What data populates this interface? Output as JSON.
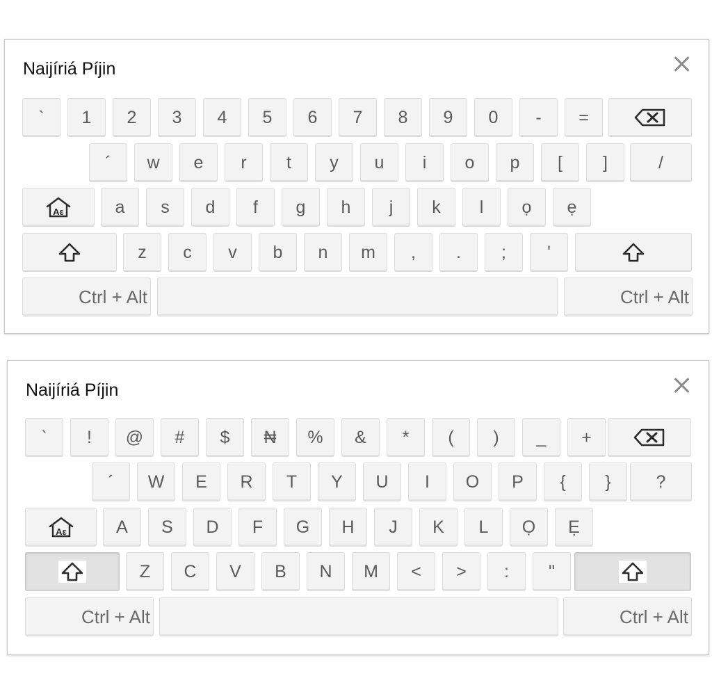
{
  "colors": {
    "panel_bg": "#ffffff",
    "panel_border": "#c8c8c8",
    "key_bg": "#f3f3f3",
    "key_border": "#dcdcdc",
    "key_active_bg": "#e2e2e2",
    "key_text": "#5a5a5a",
    "title_text": "#111111",
    "close_icon": "#8a8a8a"
  },
  "icons": {
    "backspace": "backspace-icon",
    "shift": "shift-icon",
    "layout": "home-layout-icon",
    "close": "close-icon"
  },
  "keyboards": [
    {
      "title": "Naijíriá Píjin",
      "rows": [
        [
          "`",
          "1",
          "2",
          "3",
          "4",
          "5",
          "6",
          "7",
          "8",
          "9",
          "0",
          "-",
          "=",
          "⌫"
        ],
        [
          "´",
          "w",
          "e",
          "r",
          "t",
          "y",
          "u",
          "i",
          "o",
          "p",
          "[",
          "]",
          "/"
        ],
        [
          "⌂",
          "a",
          "s",
          "d",
          "f",
          "g",
          "h",
          "j",
          "k",
          "l",
          "ọ",
          "ẹ"
        ],
        [
          "⇧",
          "z",
          "c",
          "v",
          "b",
          "n",
          "m",
          ",",
          ".",
          ";",
          "'",
          "⇧"
        ],
        [
          "Ctrl + Alt",
          "",
          "Ctrl + Alt"
        ]
      ],
      "shift_active": false
    },
    {
      "title": "Naijíriá Píjin",
      "rows": [
        [
          "`",
          "!",
          "@",
          "#",
          "$",
          "₦",
          "%",
          "&",
          "*",
          "(",
          ")",
          "_",
          "+",
          "⌫"
        ],
        [
          "´",
          "W",
          "E",
          "R",
          "T",
          "Y",
          "U",
          "I",
          "O",
          "P",
          "{",
          "}",
          "?"
        ],
        [
          "⌂",
          "A",
          "S",
          "D",
          "F",
          "G",
          "H",
          "J",
          "K",
          "L",
          "Ọ",
          "Ẹ"
        ],
        [
          "⇧",
          "Z",
          "C",
          "V",
          "B",
          "N",
          "M",
          "<",
          ">",
          ":",
          "\"",
          "⇧"
        ],
        [
          "Ctrl + Alt",
          "",
          "Ctrl + Alt"
        ]
      ],
      "shift_active": true
    }
  ]
}
